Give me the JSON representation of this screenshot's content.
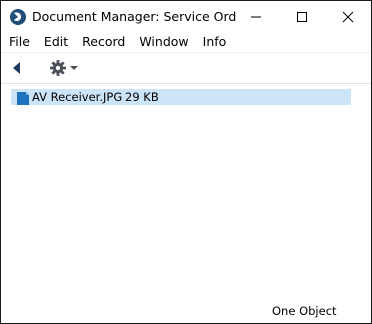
{
  "window": {
    "title": "Document Manager: Service Order: ...",
    "icons": {
      "app": "app-logo-icon",
      "minimize": "minimize-icon",
      "maximize": "maximize-icon",
      "close": "close-icon"
    }
  },
  "menubar": {
    "items": [
      {
        "label": "File"
      },
      {
        "label": "Edit"
      },
      {
        "label": "Record"
      },
      {
        "label": "Window"
      },
      {
        "label": "Info"
      }
    ]
  },
  "toolbar": {
    "back_icon": "triangle-left-icon",
    "operations_icon": "gear-icon",
    "operations_dropdown_icon": "caret-down-icon"
  },
  "documents": [
    {
      "name": "AV Receiver.JPG",
      "size": "29 KB",
      "icon": "file-icon",
      "selected": true
    }
  ],
  "status": {
    "text": "One Object"
  },
  "colors": {
    "selection": "#cce4f7",
    "file_icon": "#1e73be"
  }
}
